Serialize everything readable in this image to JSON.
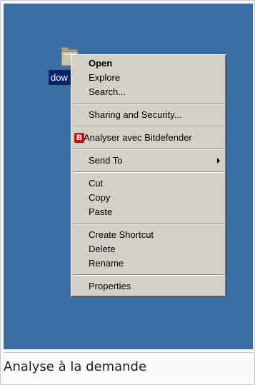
{
  "desktop": {
    "background_color": "#3a6ea5",
    "folder_label": "dow"
  },
  "context_menu": {
    "items": [
      {
        "label": "Open"
      },
      {
        "label": "Explore"
      },
      {
        "label": "Search..."
      },
      {
        "label": "Sharing and Security..."
      },
      {
        "label": "Analyser avec Bitdefender",
        "icon": "bitdefender-icon",
        "icon_text": "B"
      },
      {
        "label": "Send To"
      },
      {
        "label": "Cut"
      },
      {
        "label": "Copy"
      },
      {
        "label": "Paste"
      },
      {
        "label": "Create Shortcut"
      },
      {
        "label": "Delete"
      },
      {
        "label": "Rename"
      },
      {
        "label": "Properties"
      }
    ]
  },
  "caption": "Analyse à la demande"
}
